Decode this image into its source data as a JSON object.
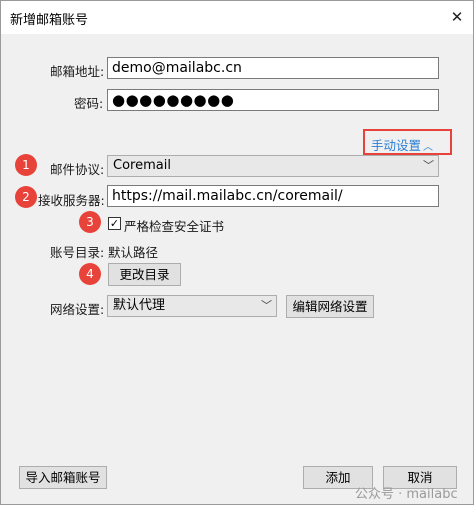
{
  "window": {
    "title": "新增邮箱账号",
    "close_glyph": "✕"
  },
  "form": {
    "email_label": "邮箱地址:",
    "email_value": "demo@mailabc.cn",
    "password_label": "密码:",
    "password_value": "●●●●●●●●●",
    "manual_settings_label": "手动设置",
    "manual_settings_icon": "chevron-up-icon",
    "protocol_label": "邮件协议:",
    "protocol_value": "Coremail",
    "server_label": "接收服务器:",
    "server_value": "https://mail.mailabc.cn/coremail/",
    "strict_check_label": "严格检查安全证书",
    "strict_check_checked": true,
    "account_dir_label": "账号目录:",
    "account_dir_value": "默认路径",
    "change_dir_button": "更改目录",
    "network_label": "网络设置:",
    "network_value": "默认代理",
    "edit_network_button": "编辑网络设置"
  },
  "footer": {
    "import_button": "导入邮箱账号",
    "add_button": "添加",
    "cancel_button": "取消"
  },
  "annotations": {
    "one": "1",
    "two": "2",
    "three": "3",
    "four": "4",
    "color": "#e8433a"
  },
  "watermark": "公众号 · mailabc",
  "colors": {
    "link": "#2a7fd4",
    "highlight_border": "#e8433a"
  }
}
